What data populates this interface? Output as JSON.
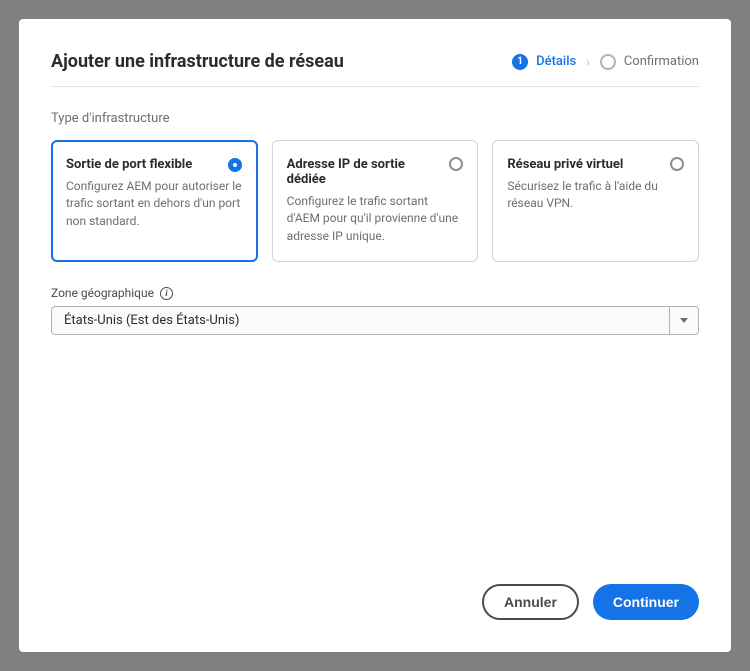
{
  "header": {
    "title": "Ajouter une infrastructure de réseau"
  },
  "steps": {
    "one": {
      "number": "1",
      "label": "Détails"
    },
    "two": {
      "label": "Confirmation"
    }
  },
  "type_section": {
    "label": "Type d'infrastructure"
  },
  "cards": {
    "flex": {
      "title": "Sortie de port flexible",
      "desc": "Configurez AEM pour autoriser le trafic sortant en dehors d'un port non standard."
    },
    "ip": {
      "title": "Adresse IP de sortie dédiée",
      "desc": "Configurez le trafic sortant d'AEM pour qu'il provienne d'une adresse IP unique."
    },
    "vpn": {
      "title": "Réseau privé virtuel",
      "desc": "Sécurisez le trafic à l'aide du réseau VPN."
    }
  },
  "zone": {
    "label": "Zone géographique",
    "value": "États-Unis (Est des États-Unis)"
  },
  "footer": {
    "cancel": "Annuler",
    "continue": "Continuer"
  }
}
